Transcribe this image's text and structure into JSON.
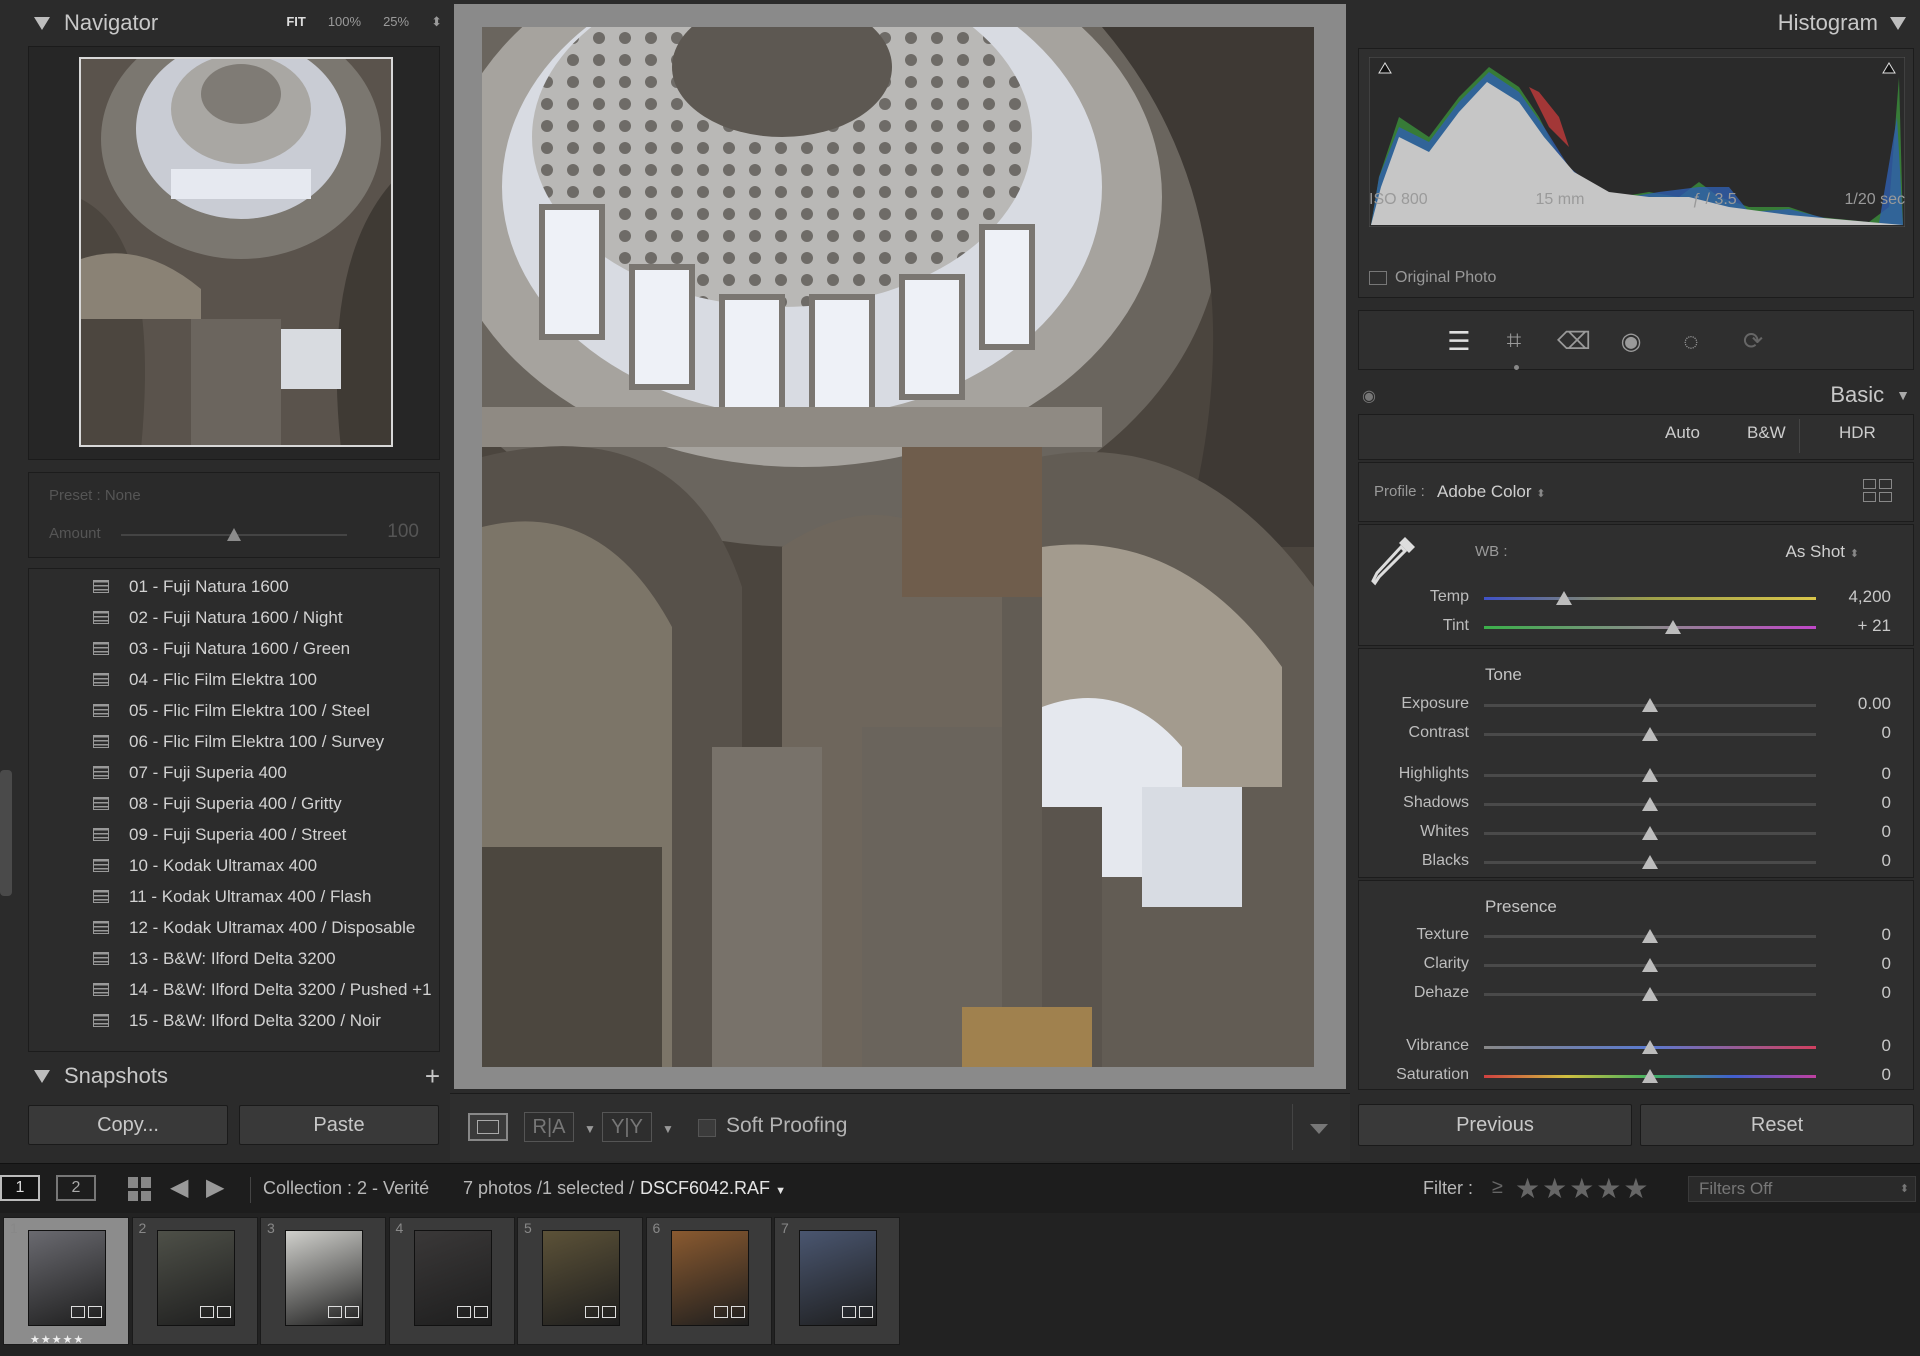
{
  "left": {
    "navigator": {
      "title": "Navigator",
      "fit": "FIT",
      "zoom1": "100%",
      "zoom2": "25%"
    },
    "preset_amount": {
      "preset_label": "Preset : None",
      "amount_label": "Amount",
      "amount_value": "100",
      "amount_level": 0.5
    },
    "presets": [
      "01 - Fuji Natura 1600",
      "02 - Fuji Natura 1600 / Night",
      "03 - Fuji Natura 1600 / Green",
      "04 - Flic Film Elektra 100",
      "05 - Flic Film Elektra 100 / Steel",
      "06 - Flic Film Elektra 100 / Survey",
      "07 - Fuji Superia 400",
      "08 - Fuji Superia 400 / Gritty",
      "09 - Fuji Superia 400 / Street",
      "10 - Kodak Ultramax 400",
      "11 - Kodak Ultramax 400 / Flash",
      "12 - Kodak Ultramax 400 / Disposable",
      "13 - B&W: Ilford Delta 3200",
      "14 - B&W: Ilford Delta 3200 / Pushed +1",
      "15 - B&W: Ilford Delta 3200 / Noir"
    ],
    "snapshots": {
      "title": "Snapshots",
      "add": "+"
    },
    "copy": "Copy...",
    "paste": "Paste"
  },
  "center": {
    "toolbar": {
      "soft_proofing": "Soft Proofing"
    }
  },
  "right": {
    "histogram": {
      "title": "Histogram",
      "iso": "ISO 800",
      "focal": "15 mm",
      "aperture": "ƒ / 3.5",
      "shutter": "1/20 sec",
      "original_photo": "Original Photo"
    },
    "tools": [
      "sliders-icon",
      "crop-icon",
      "heal-icon",
      "red-eye-icon",
      "mask-icon",
      "presets-icon"
    ],
    "basic": {
      "title": "Basic",
      "auto": "Auto",
      "bw": "B&W",
      "hdr": "HDR",
      "profile_label": "Profile :",
      "profile_value": "Adobe Color",
      "wb_label": "WB :",
      "wb_value": "As Shot",
      "temp": {
        "label": "Temp",
        "value": "4,200",
        "level": 0.24
      },
      "tint": {
        "label": "Tint",
        "value": "+ 21",
        "level": 0.57
      },
      "tone_label": "Tone",
      "tone": [
        {
          "label": "Exposure",
          "value": "0.00",
          "level": 0.5
        },
        {
          "label": "Contrast",
          "value": "0",
          "level": 0.5
        },
        {
          "label": "Highlights",
          "value": "0",
          "level": 0.5
        },
        {
          "label": "Shadows",
          "value": "0",
          "level": 0.5
        },
        {
          "label": "Whites",
          "value": "0",
          "level": 0.5
        },
        {
          "label": "Blacks",
          "value": "0",
          "level": 0.5
        }
      ],
      "presence_label": "Presence",
      "presence": [
        {
          "label": "Texture",
          "value": "0",
          "level": 0.5
        },
        {
          "label": "Clarity",
          "value": "0",
          "level": 0.5
        },
        {
          "label": "Dehaze",
          "value": "0",
          "level": 0.5
        },
        {
          "label": "Vibrance",
          "value": "0",
          "level": 0.5
        },
        {
          "label": "Saturation",
          "value": "0",
          "level": 0.5
        }
      ]
    },
    "previous": "Previous",
    "reset": "Reset"
  },
  "bar": {
    "screen1": "1",
    "screen2": "2",
    "collection": "Collection : 2 - Verité",
    "count": "7 photos /1 selected /",
    "filename": "DSCF6042.RAF",
    "filter_label": "Filter :",
    "filter_op": "≥",
    "stars": "★★★★★",
    "filters_off": "Filters Off"
  },
  "filmstrip": [
    {
      "num": "1",
      "stars": "★★★★★",
      "selected": true
    },
    {
      "num": "2",
      "stars": ""
    },
    {
      "num": "3",
      "stars": ""
    },
    {
      "num": "4",
      "stars": ""
    },
    {
      "num": "5",
      "stars": ""
    },
    {
      "num": "6",
      "stars": ""
    },
    {
      "num": "7",
      "stars": ""
    }
  ]
}
